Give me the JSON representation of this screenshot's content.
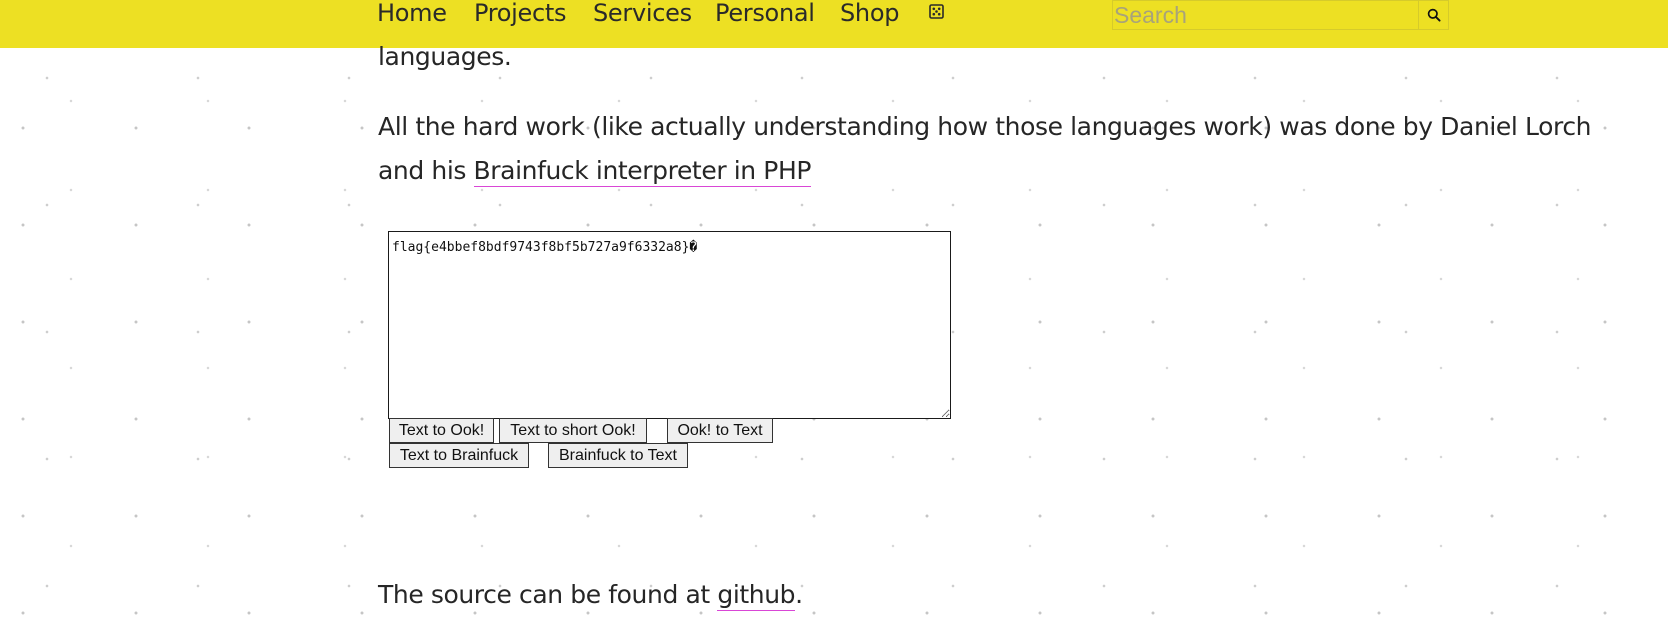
{
  "nav": {
    "items": [
      {
        "label": "Home"
      },
      {
        "label": "Projects"
      },
      {
        "label": "Services"
      },
      {
        "label": "Personal"
      },
      {
        "label": "Shop"
      }
    ],
    "dice_icon": "dice-icon",
    "search": {
      "placeholder": "Search",
      "value": "",
      "icon": "search-icon"
    },
    "accent_color": "#ede023"
  },
  "content": {
    "languages_tail": "languages.",
    "hardwork_line1": "All the hard work (like actually understanding how those languages work) was done by Daniel Lorch",
    "hardwork_line2_prefix": "and his ",
    "interpreter_link": "Brainfuck interpreter in PHP",
    "textarea_value": "flag{e4bbef8bdf9743f8bf5b727a9f6332a8}�",
    "buttons": {
      "text_to_ook": "Text to Ook!",
      "text_to_short_ook": "Text to short Ook!",
      "ook_to_text": "Ook! to Text",
      "text_to_brainfuck": "Text to Brainfuck",
      "brainfuck_to_text": "Brainfuck to Text"
    },
    "source_prefix": "The source can be found at ",
    "source_link": "github",
    "source_suffix": ".",
    "link_underline_color": "#d946d6"
  }
}
